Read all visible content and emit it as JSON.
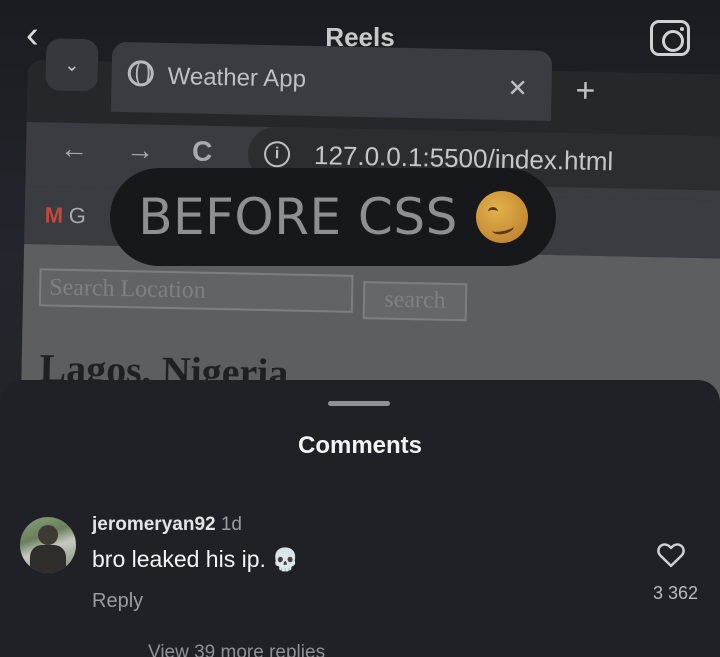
{
  "video": {
    "browser": {
      "tab_title": "Weather App",
      "tab_close": "✕",
      "new_tab": "+",
      "dropdown": "⌄",
      "back": "←",
      "forward": "→",
      "reload": "C",
      "url_info": "i",
      "url": "127.0.0.1:5500/index.html",
      "gmail": "M",
      "bookmark_g": "G"
    },
    "page": {
      "search_placeholder": "Search Location",
      "search_button": "search",
      "city": "Lagos, Nigeria"
    },
    "caption": "BEFORE CSS"
  },
  "top_bar": {
    "back_icon": "‹",
    "title": "Reels"
  },
  "comments": {
    "title": "Comments",
    "items": [
      {
        "username": "jeromeryan92",
        "time": "1d",
        "text": "bro leaked his ip.",
        "emoji": "💀",
        "reply_label": "Reply",
        "likes": "3 362",
        "view_more": "View 39 more replies"
      }
    ]
  }
}
